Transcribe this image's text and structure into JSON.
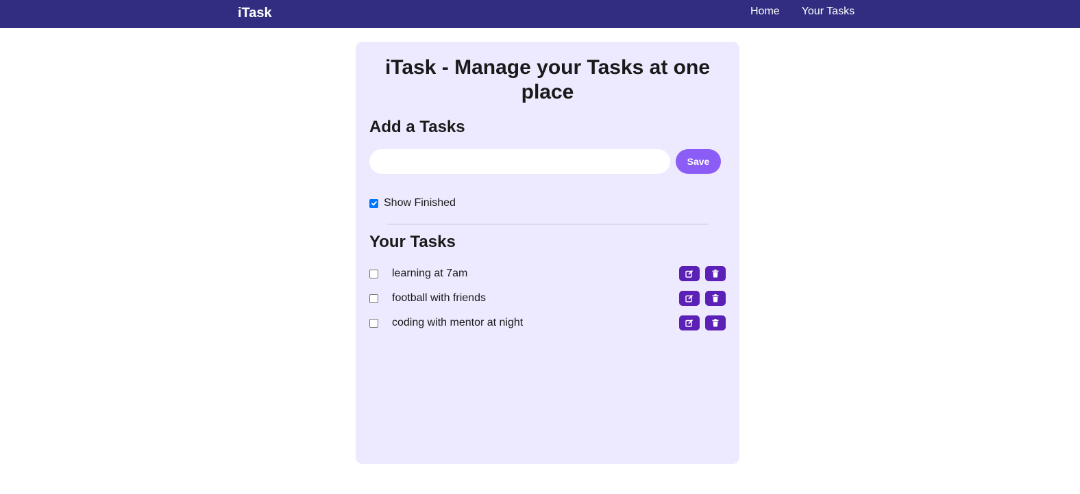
{
  "navbar": {
    "brand": "iTask",
    "links": [
      "Home",
      "Your Tasks"
    ],
    "background_color": "#312e81"
  },
  "card": {
    "title": "iTask - Manage your Tasks at one place",
    "add_heading": "Add a Tasks",
    "input": {
      "value": "",
      "placeholder": ""
    },
    "save_label": "Save",
    "show_finished": {
      "label": "Show Finished",
      "checked": true
    },
    "tasks_heading": "Your Tasks",
    "tasks": [
      {
        "text": "learning at 7am",
        "done": false
      },
      {
        "text": "football with friends",
        "done": false
      },
      {
        "text": "coding with mentor at night",
        "done": false
      }
    ],
    "icons": {
      "edit": "edit-icon",
      "delete": "trash-icon"
    },
    "colors": {
      "card_bg": "#ede9fe",
      "save_btn": "#8b5cf6",
      "action_btn": "#5b21b6"
    }
  }
}
